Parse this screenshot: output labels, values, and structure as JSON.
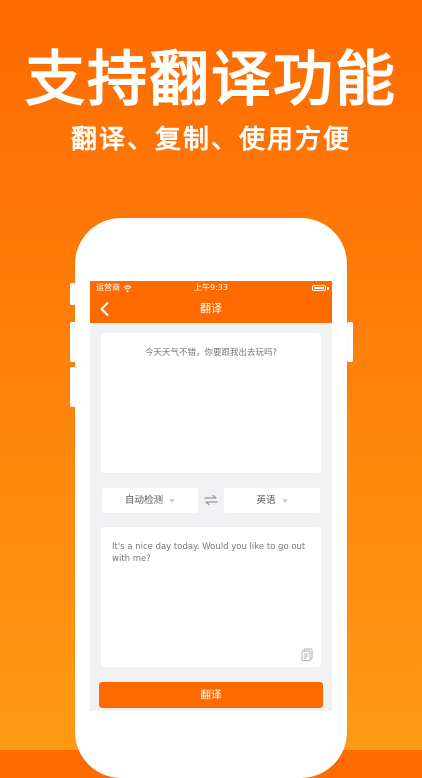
{
  "promo": {
    "headline": "支持翻译功能",
    "subline": "翻译、复制、使用方便"
  },
  "status_bar": {
    "carrier": "运营商",
    "time": "上午9:33"
  },
  "nav": {
    "title": "翻译",
    "back_icon": "chevron-left-icon"
  },
  "source": {
    "text": "今天天气不错，你要跟我出去玩吗?"
  },
  "languages": {
    "source": "自动检测",
    "target": "英语",
    "swap_icon": "swap-arrows-icon"
  },
  "result": {
    "text": "It's a nice day today. Would you like to go out with me?",
    "copy_icon": "copy-icon"
  },
  "actions": {
    "translate_label": "翻译"
  },
  "colors": {
    "accent": "#ff6a00",
    "background_top": "#ff6a00",
    "background_bottom": "#ff9a12",
    "screen_bg": "#f1f1f3"
  }
}
